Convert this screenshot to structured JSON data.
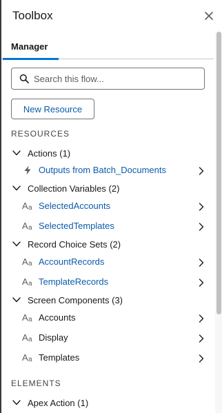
{
  "header": {
    "title": "Toolbox"
  },
  "tabs": [
    {
      "label": "Manager"
    }
  ],
  "search": {
    "placeholder": "Search this flow..."
  },
  "new_resource_label": "New Resource",
  "sections": {
    "resources": "RESOURCES",
    "elements": "ELEMENTS"
  },
  "groups": [
    {
      "label": "Actions (1)",
      "items": [
        {
          "label": "Outputs from Batch_Documents",
          "icon": "bolt-icon"
        }
      ]
    },
    {
      "label": "Collection Variables (2)",
      "items": [
        {
          "label": "SelectedAccounts",
          "icon": "text-aa-icon"
        },
        {
          "label": "SelectedTemplates",
          "icon": "text-aa-icon"
        }
      ]
    },
    {
      "label": "Record Choice Sets (2)",
      "items": [
        {
          "label": "AccountRecords",
          "icon": "text-aa-icon"
        },
        {
          "label": "TemplateRecords",
          "icon": "text-aa-icon"
        }
      ]
    },
    {
      "label": "Screen Components (3)",
      "items": [
        {
          "label": "Accounts",
          "icon": "text-aa-icon"
        },
        {
          "label": "Display",
          "icon": "text-aa-icon"
        },
        {
          "label": "Templates",
          "icon": "text-aa-icon"
        }
      ]
    }
  ],
  "element_groups": [
    {
      "label": "Apex Action (1)"
    }
  ],
  "icon_glyphs": {
    "text_big": "A",
    "text_small": "a"
  },
  "colors": {
    "link": "#0b5cab",
    "tab_underline": "#0176d3",
    "text": "#181818"
  }
}
